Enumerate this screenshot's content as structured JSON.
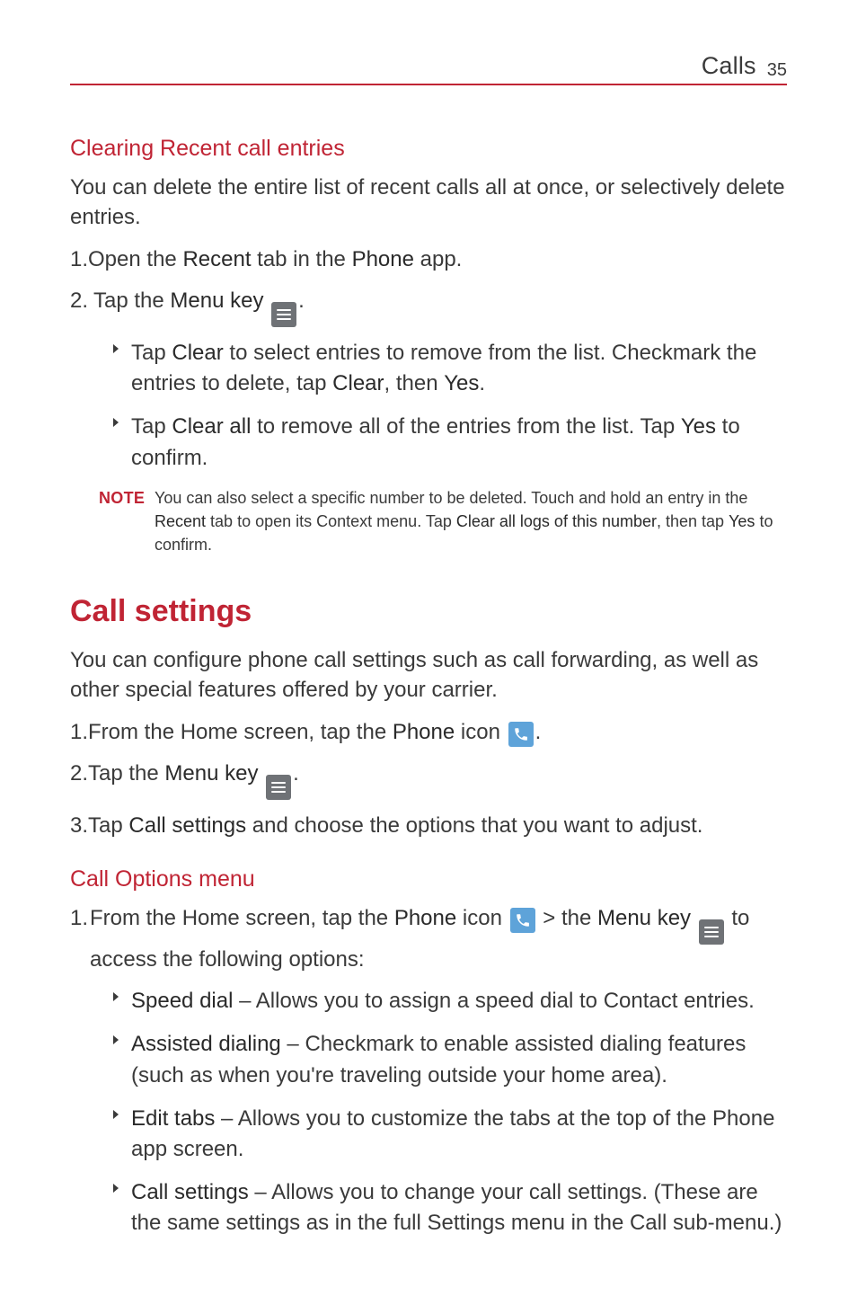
{
  "header": {
    "chapter": "Calls",
    "page_number": "35"
  },
  "clearing": {
    "heading": "Clearing Recent call entries",
    "intro": "You can delete the entire list of recent calls all at once, or selectively delete entries.",
    "steps": [
      {
        "num": "1.",
        "pre": " Open the ",
        "b1": "Recent",
        "mid": " tab in the ",
        "b2": "Phone",
        "post": " app."
      },
      {
        "num": "2.",
        "pre": " Tap the ",
        "b1": "Menu key",
        "icon": "menu",
        "post": "."
      }
    ],
    "bullets": [
      {
        "pre": "Tap ",
        "b1": "Clear",
        "mid": " to select entries to remove from the list. Checkmark the entries to delete, tap ",
        "b2": "Clear",
        "mid2": ", then ",
        "b3": "Yes",
        "post": "."
      },
      {
        "pre": "Tap ",
        "b1": "Clear all",
        "mid": " to remove all of the entries from the list. Tap ",
        "b2": "Yes",
        "post": " to confirm."
      }
    ],
    "note": {
      "label": "NOTE",
      "pre": "You can also select a specific number to be deleted. Touch and hold an entry in the ",
      "b1": "Recent",
      "mid": " tab to open its Context menu. Tap ",
      "b2": "Clear all logs of this number",
      "mid2": ", then tap ",
      "b3": "Yes",
      "post": " to confirm."
    }
  },
  "call_settings": {
    "heading": "Call settings",
    "intro": "You can configure phone call settings such as call forwarding, as well as other special features offered by your carrier.",
    "steps": [
      {
        "num": "1. ",
        "pre": " From the Home screen, tap the ",
        "b1": "Phone",
        "mid": " icon ",
        "icon": "phone",
        "post": "."
      },
      {
        "num": "2. ",
        "pre": " Tap the ",
        "b1": "Menu key",
        "icon": "menu",
        "post": "."
      },
      {
        "num": "3. ",
        "pre": " Tap ",
        "b1": "Call settings",
        "post": " and choose the options that you want to adjust."
      }
    ]
  },
  "options_menu": {
    "heading": "Call Options menu",
    "step1": {
      "num": "1.",
      "pre": " From the Home screen, tap the ",
      "b1": "Phone",
      "mid": " icon ",
      "icon1": "phone",
      "gt": " > the ",
      "b2": "Menu key",
      "icon2": "menu",
      "post": " to access the following options:"
    },
    "bullets": [
      {
        "term": "Speed dial",
        "desc": " – Allows you to assign a speed dial to Contact entries."
      },
      {
        "term": "Assisted dialing",
        "desc": " – Checkmark to enable assisted dialing features (such as when you're traveling outside your home area)."
      },
      {
        "term": "Edit tabs",
        "desc": " – Allows you to customize the tabs at the top of the Phone app screen."
      },
      {
        "term": "Call settings",
        "desc": " – Allows you to change your call settings. (These are the same settings as in the full Settings menu in the Call sub-menu.)"
      }
    ]
  }
}
